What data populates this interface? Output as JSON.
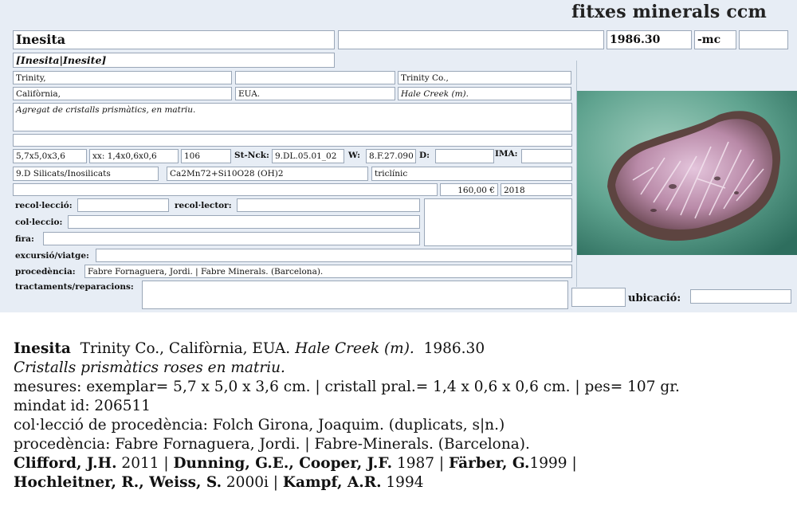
{
  "header": {
    "brand": "fitxes minerals ccm"
  },
  "card": {
    "name": "Inesita",
    "code": "1986.30",
    "suffix": "-mc",
    "synonyms": "[Inesita|Inesite]",
    "locality_1": "Trinity,",
    "locality_2": "Trinity Co.,",
    "region": "Califòrnia,",
    "country": "EUA.",
    "site": "Hale Creek (m).",
    "description": "Agregat de cristalls prismàtics, en matriu.",
    "size": "5,7x5,0x3,6",
    "crystal": "xx: 1,4x0,6x0,6",
    "weight": "106",
    "st_nck_label": "St-Nck:",
    "st_nck": "9.DL.05.01_02",
    "w_label": "W:",
    "w": "8.F.27.090",
    "d_label": "D:",
    "ima_label": "IMA:",
    "class": "9.D Silicats/Inosilicats",
    "formula": "Ca2Mn72+Si10O28 (OH)2",
    "system": "triclínic",
    "price": "160,00 €",
    "year": "2018",
    "recollecio_label": "recol·lecció:",
    "recollector_label": "recol·lector:",
    "colleccio_label": "col·leccio:",
    "fira_label": "fira:",
    "excursio_label": "excursió/viatge:",
    "procedencia_label": "procedència:",
    "procedencia": "Fabre Fornaguera, Jordi. | Fabre Minerals. (Barcelona).",
    "tractaments_label": "tractaments/reparacions:",
    "ubicacio_label": "ubicació:"
  },
  "details": {
    "name": "Inesita",
    "locality": "Trinity Co., Califòrnia, EUA.",
    "site": "Hale Creek (m).",
    "code": "1986.30",
    "short_desc": "Cristalls prismàtics roses en matriu.",
    "measures": "mesures: exemplar= 5,7 x 5,0 x 3,6 cm. | cristall pral.= 1,4 x 0,6 x 0,6 cm. | pes= 107 gr.",
    "mindat": "mindat id: 206511",
    "coll_proc": "col·lecció de procedència: Folch Girona, Joaquim. (duplicats, s|n.)",
    "procedencia": "procedència: Fabre Fornaguera, Jordi. | Fabre-Minerals. (Barcelona).",
    "refs1": [
      {
        "author": "Clifford, J.H.",
        "year": " 2011 | "
      },
      {
        "author": "Dunning, G.E., Cooper, J.F.",
        "year": " 1987 | "
      },
      {
        "author": "Färber, G.",
        "year": "1999 |"
      }
    ],
    "refs2": [
      {
        "author": "Hochleitner, R., Weiss, S.",
        "year": " 2000i | "
      },
      {
        "author": "Kampf, A.R.",
        "year": " 1994"
      }
    ]
  }
}
